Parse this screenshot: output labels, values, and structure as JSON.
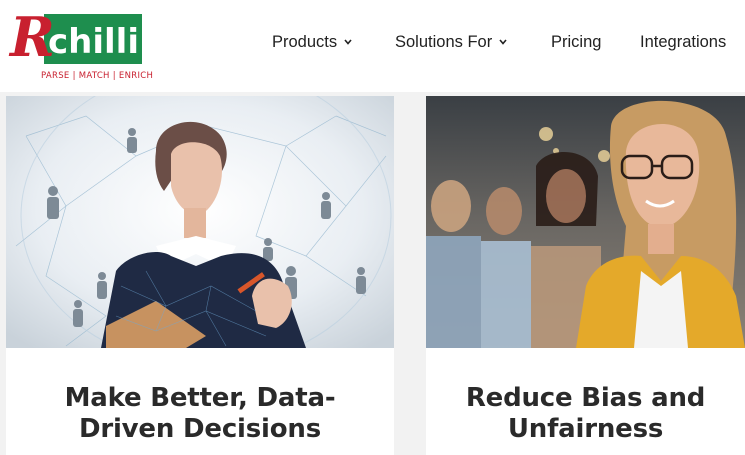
{
  "brand": {
    "name": "chilli",
    "initial": "R",
    "tagline_parts": [
      "PARSE",
      "MATCH",
      "ENRICH"
    ],
    "tagline_separator": " | ",
    "tagline": "PARSE | MATCH | ENRICH",
    "colors": {
      "red": "#c8202f",
      "green": "#1e8e4e"
    }
  },
  "nav": {
    "items": [
      {
        "label": "Products",
        "has_dropdown": true
      },
      {
        "label": "Solutions For",
        "has_dropdown": true
      },
      {
        "label": "Pricing",
        "has_dropdown": false
      },
      {
        "label": "Integrations",
        "has_dropdown": false
      }
    ]
  },
  "cards": [
    {
      "title": "Make Better, Data-Driven Decisions",
      "title_line1": "Make Better, Data-",
      "title_line2": "Driven Decisions",
      "image_icon": "woman-network-photo"
    },
    {
      "title": "Reduce Bias and Unfairness",
      "title_line1": "Reduce Bias and",
      "title_line2": "Unfairness",
      "image_icon": "diverse-team-photo"
    }
  ]
}
